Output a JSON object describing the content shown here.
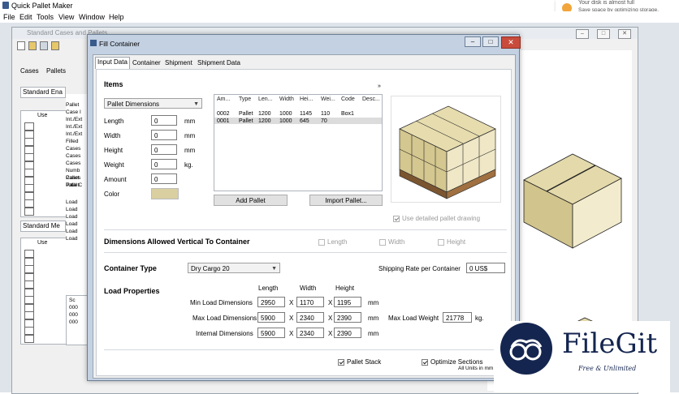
{
  "app": {
    "title": "Quick Pallet Maker"
  },
  "menu": [
    "File",
    "Edit",
    "Tools",
    "View",
    "Window",
    "Help"
  ],
  "notification": {
    "line1": "Your disk is almost full",
    "line2": "Save space by optimizing storage."
  },
  "bg_window": {
    "title": "Standard Cases and Pallets",
    "tabs": [
      "Cases",
      "Pallets"
    ],
    "left_items": [
      "Standard Ena",
      "Standard Me"
    ],
    "col_use": "Use",
    "labels": [
      "Pallet",
      "Case I",
      "Int./Ext",
      "Int./Ext",
      "Int./Ext",
      "Filled",
      "Cases",
      "Cases",
      "Cases",
      "Numb",
      "Cases",
      "Total C",
      "Pallet",
      "Pallet",
      "Load",
      "Load",
      "Load",
      "Load",
      "Load",
      "Load"
    ],
    "bottom_rows": [
      "Sc",
      "000",
      "000",
      "000"
    ]
  },
  "dialog": {
    "title": "Fill Container",
    "tabs": [
      "Input Data",
      "Container",
      "Shipment",
      "Shipment Data"
    ],
    "items_heading": "Items",
    "pallet_dropdown": "Pallet Dimensions",
    "fields": [
      {
        "label": "Length",
        "value": "0",
        "unit": "mm"
      },
      {
        "label": "Width",
        "value": "0",
        "unit": "mm"
      },
      {
        "label": "Height",
        "value": "0",
        "unit": "mm"
      },
      {
        "label": "Weight",
        "value": "0",
        "unit": "kg."
      },
      {
        "label": "Amount",
        "value": "0",
        "unit": ""
      }
    ],
    "color_label": "Color",
    "color_swatch": "#d9cfa0",
    "grid_headers": [
      "Am...",
      "Type",
      "Len...",
      "Width",
      "Hei...",
      "Wei...",
      "Code",
      "Desc..."
    ],
    "grid_rows": [
      [
        "0002",
        "Pallet",
        "1200",
        "1000",
        "1145",
        "110",
        "Box1",
        ""
      ],
      [
        "0001",
        "Pallet",
        "1200",
        "1000",
        "645",
        "70",
        "",
        ""
      ]
    ],
    "add_pallet": "Add Pallet",
    "import_pallet": "Import Pallet...",
    "use_detailed": "Use detailed pallet drawing",
    "dim_allowed_heading": "Dimensions Allowed Vertical To Container",
    "dim_checks": [
      "Length",
      "Width",
      "Height"
    ],
    "container_type_label": "Container Type",
    "container_type_value": "Dry Cargo 20",
    "shipping_rate_label": "Shipping Rate per Container",
    "shipping_rate_value": "0 US$",
    "load_props_heading": "Load Properties",
    "col_heads": [
      "Length",
      "Width",
      "Height"
    ],
    "load_rows": [
      {
        "label": "Min Load Dimensions",
        "values": [
          "2950",
          "1170",
          "1195"
        ],
        "unit": "mm"
      },
      {
        "label": "Max Load Dimensions",
        "values": [
          "5900",
          "2340",
          "2390"
        ],
        "unit": "mm"
      },
      {
        "label": "Internal Dimensions",
        "values": [
          "5900",
          "2340",
          "2390"
        ],
        "unit": "mm"
      }
    ],
    "x_sep": "X",
    "max_load_weight_label": "Max Load Weight",
    "max_load_weight_value": "21778",
    "max_load_weight_unit": "kg.",
    "pallet_stack": "Pallet Stack",
    "optimize_sections": "Optimize Sections",
    "units_note": "All Units in mm"
  },
  "watermark": {
    "name": "FileGit",
    "tagline": "Free & Unlimited"
  }
}
